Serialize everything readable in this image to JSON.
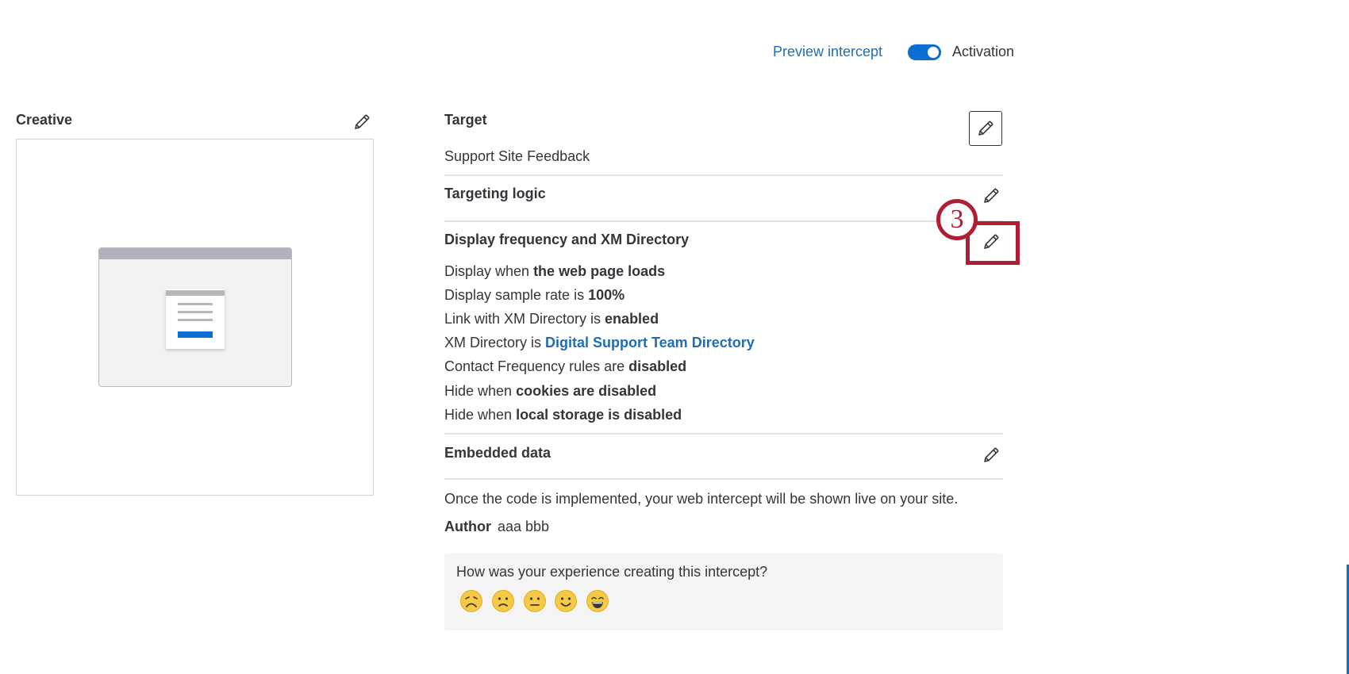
{
  "header": {
    "preview_link": "Preview intercept",
    "activation_label": "Activation",
    "activation_on": true
  },
  "creative": {
    "heading": "Creative"
  },
  "target": {
    "heading": "Target",
    "value": "Support Site Feedback"
  },
  "targeting_logic": {
    "heading": "Targeting logic"
  },
  "display_frequency": {
    "heading": "Display frequency and XM Directory",
    "rows": [
      {
        "prefix": "Display when ",
        "value": "the web page loads"
      },
      {
        "prefix": "Display sample rate is ",
        "value": "100%"
      },
      {
        "prefix": "Link with XM Directory is ",
        "value": "enabled"
      },
      {
        "prefix": "XM Directory is ",
        "value": "Digital Support Team Directory"
      },
      {
        "prefix": "Contact Frequency rules are ",
        "value": "disabled"
      },
      {
        "prefix": "Hide when ",
        "value": "cookies are disabled"
      },
      {
        "prefix": "Hide when ",
        "value": "local storage is disabled"
      }
    ]
  },
  "embedded_data": {
    "heading": "Embedded data"
  },
  "footer": {
    "implementation_note": "Once the code is implemented, your web intercept will be shown live on your site.",
    "author_label": "Author",
    "author_value": "aaa bbb"
  },
  "feedback": {
    "question": "How was your experience creating this intercept?",
    "options": [
      "very-dissatisfied-face-icon",
      "dissatisfied-face-icon",
      "neutral-face-icon",
      "satisfied-face-icon",
      "very-satisfied-face-icon"
    ]
  },
  "annotation": {
    "step_number": "3"
  },
  "colors": {
    "link": "#1f6eb3",
    "toggle_on": "#0b6ed0",
    "annotation": "#b01e33",
    "emoji": "#f6c945"
  }
}
